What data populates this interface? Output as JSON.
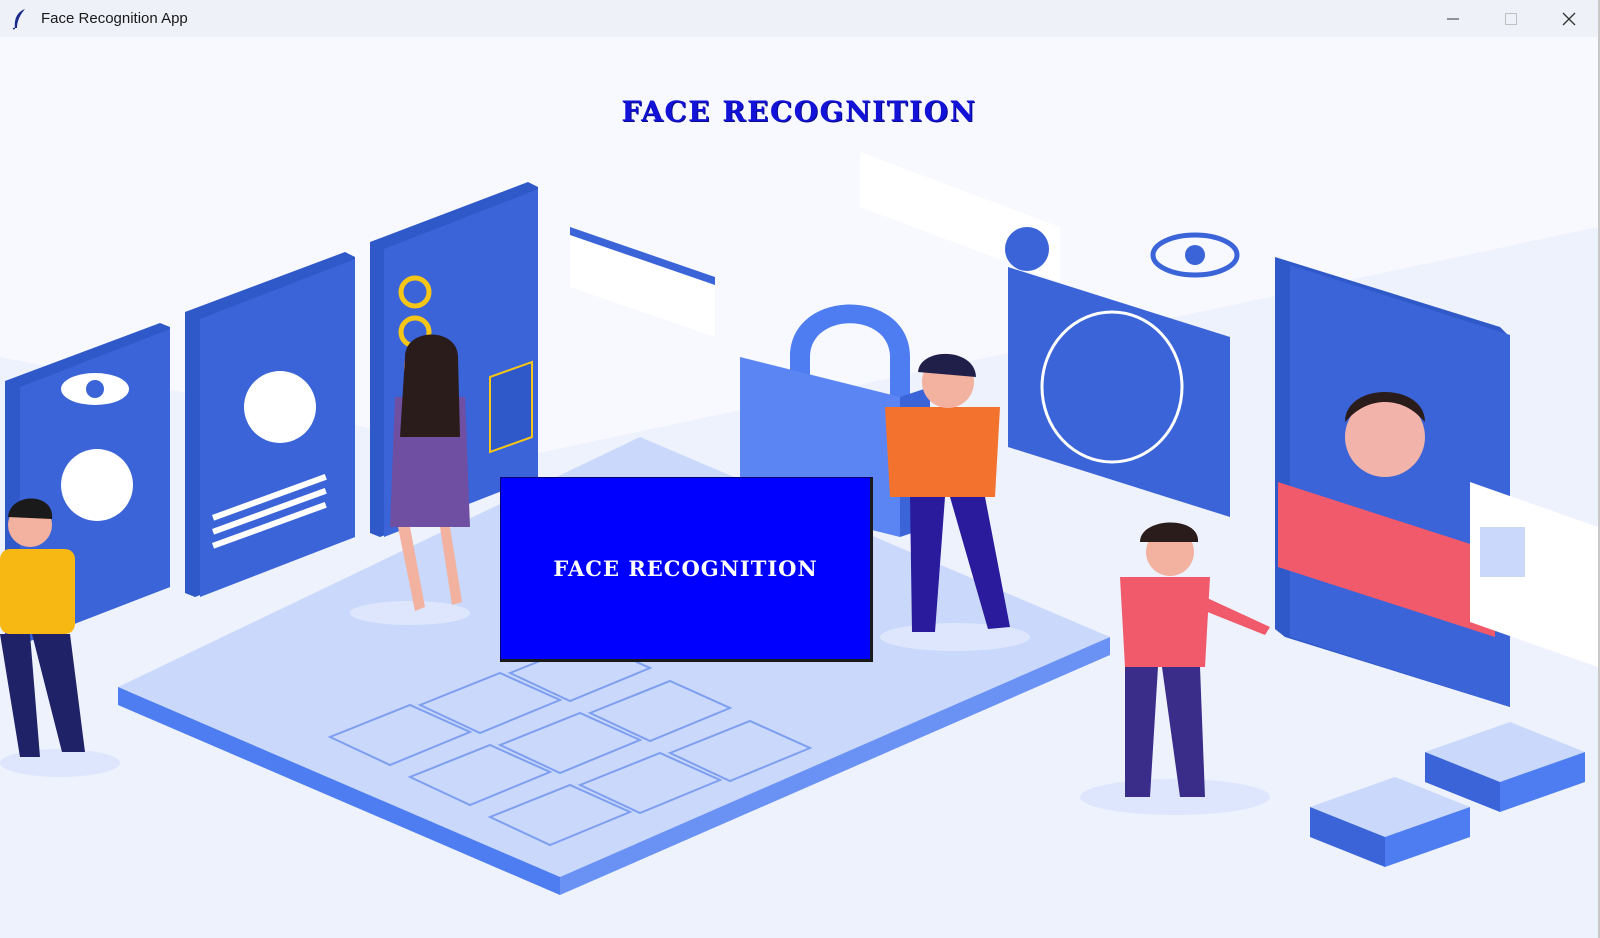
{
  "window": {
    "title": "Face Recognition App",
    "icon": "feather-icon",
    "controls": {
      "minimize_icon": "minimize-icon",
      "maximize_icon": "maximize-icon",
      "close_icon": "close-icon"
    }
  },
  "main": {
    "heading": "FACE RECOGNITION",
    "button_label": "FACE RECOGNITION",
    "illustration": "face-recognition-illustration"
  },
  "colors": {
    "heading": "#1212d8",
    "button_bg": "#0000ff",
    "button_text": "#ffffff",
    "illustration_primary": "#3a64d8",
    "illustration_light": "#c9d8fb"
  }
}
